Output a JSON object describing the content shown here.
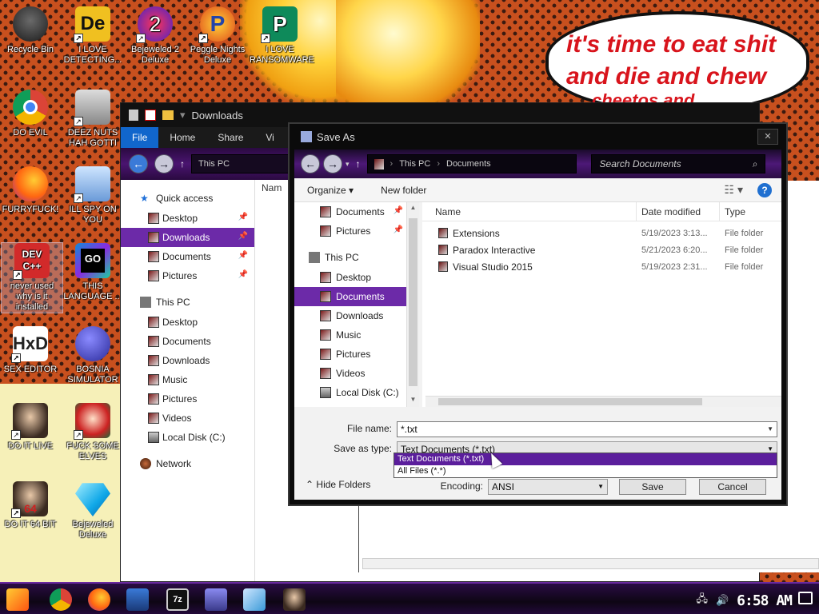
{
  "wallpaper": {
    "speech_line1": "it's time to eat shit",
    "speech_line2": "and die and chew",
    "speech_line3": "cheetos and"
  },
  "desktop_icons": [
    {
      "label": "Recycle Bin",
      "icon": "recycle-bin-icon"
    },
    {
      "label": "I LOVE DETECTING...",
      "icon": "detect-it-easy-icon"
    },
    {
      "label": "Bejeweled 2 Deluxe",
      "icon": "bejeweled2-icon"
    },
    {
      "label": "Peggle Nights Deluxe",
      "icon": "peggle-icon"
    },
    {
      "label": "I LOVE RANSOMWARE",
      "icon": "publisher-icon"
    },
    {
      "label": "DO EVIL",
      "icon": "chrome-icon"
    },
    {
      "label": "DEEZ NUTS HAH GOTTI",
      "icon": "copy-icon"
    },
    {
      "label": "FURRYFUCK!",
      "icon": "firefox-icon"
    },
    {
      "label": "ILL SPY ON YOU",
      "icon": "network-spy-icon"
    },
    {
      "label": "never used why is it installed",
      "icon": "devcpp-icon"
    },
    {
      "label": "THIS LANGUAGE ...",
      "icon": "goland-icon"
    },
    {
      "label": "SEX EDITOR",
      "icon": "hxd-icon"
    },
    {
      "label": "BOSNIA SIMULATOR",
      "icon": "mine-icon"
    },
    {
      "label": "DO IT LIVE",
      "icon": "portrait-icon"
    },
    {
      "label": "FUCK SOME ELVES",
      "icon": "santa-icon"
    },
    {
      "label": "DO IT 64 BIT",
      "icon": "portrait64-icon"
    },
    {
      "label": "Bejeweled Deluxe",
      "icon": "diamond-icon"
    }
  ],
  "explorer": {
    "title": "Downloads",
    "tabs": [
      "File",
      "Home",
      "Share",
      "Vi"
    ],
    "address": "This PC",
    "quick_access_label": "Quick access",
    "quick_items": [
      "Desktop",
      "Downloads",
      "Documents",
      "Pictures"
    ],
    "this_pc_label": "This PC",
    "pc_items": [
      "Desktop",
      "Documents",
      "Downloads",
      "Music",
      "Pictures",
      "Videos",
      "Local Disk (C:)"
    ],
    "network_label": "Network",
    "col_name": "Nam"
  },
  "dialog": {
    "title": "Save As",
    "close_label": "✕",
    "address_parts": [
      "This PC",
      "Documents"
    ],
    "search_placeholder": "Search Documents",
    "organize_label": "Organize ▾",
    "new_folder_label": "New folder",
    "nav_items_top": [
      "Documents",
      "Pictures"
    ],
    "this_pc_label": "This PC",
    "nav_items_pc": [
      "Desktop",
      "Documents",
      "Downloads",
      "Music",
      "Pictures",
      "Videos",
      "Local Disk (C:)"
    ],
    "columns": [
      "Name",
      "Date modified",
      "Type"
    ],
    "files": [
      {
        "name": "Extensions",
        "date": "5/19/2023 3:13...",
        "type": "File folder"
      },
      {
        "name": "Paradox Interactive",
        "date": "5/21/2023 6:20...",
        "type": "File folder"
      },
      {
        "name": "Visual Studio 2015",
        "date": "5/19/2023 2:31...",
        "type": "File folder"
      }
    ],
    "file_name_label": "File name:",
    "file_name_value": "*.txt",
    "save_type_label": "Save as type:",
    "save_type_value": "Text Documents (*.txt)",
    "type_options": [
      "Text Documents (*.txt)",
      "All Files  (*.*)"
    ],
    "hide_folders_label": "Hide Folders",
    "encoding_label": "Encoding:",
    "encoding_value": "ANSI",
    "save_label": "Save",
    "cancel_label": "Cancel"
  },
  "taskbar": {
    "clock": "6:58 AM",
    "apps": [
      "start",
      "chrome",
      "firefox",
      "terminal",
      "file-explorer",
      "7zip",
      "monitor",
      "notepad",
      "portrait"
    ]
  },
  "colors": {
    "accent": "#6c2aa8",
    "selection": "#5b1e9c",
    "help": "#1f6fd0",
    "speech_red": "#d8141c"
  }
}
